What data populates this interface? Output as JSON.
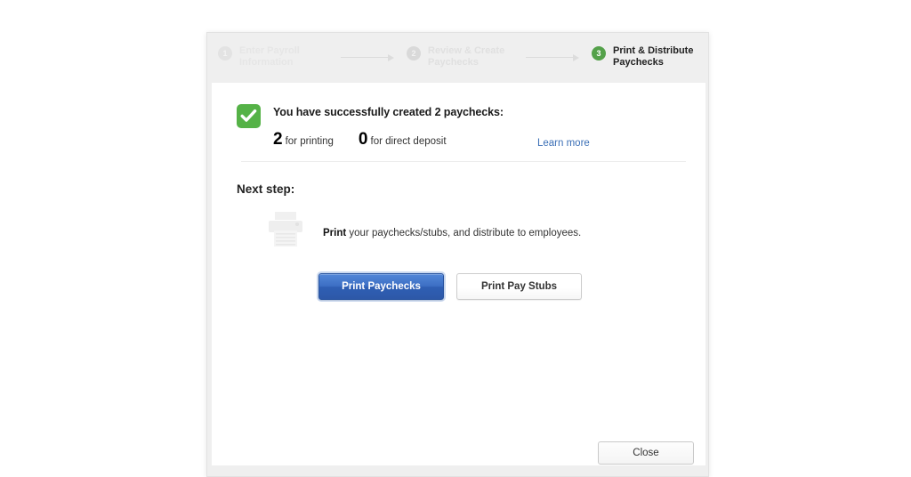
{
  "stepper": {
    "steps": [
      {
        "number": "1",
        "line1": "Enter Payroll",
        "line2": "Information",
        "state": "done-faint"
      },
      {
        "number": "2",
        "line1": "Review & Create",
        "line2": "Paychecks",
        "state": "done"
      },
      {
        "number": "3",
        "line1": "Print & Distribute",
        "line2": "Paychecks",
        "state": "active"
      }
    ]
  },
  "success": {
    "icon": "green-check-icon",
    "headline": "You have successfully created 2 paychecks:",
    "counts": [
      {
        "number": "2",
        "caption": "for printing"
      },
      {
        "number": "0",
        "caption": "for direct deposit"
      }
    ],
    "learn_more_label": "Learn more"
  },
  "next_step": {
    "title": "Next step:",
    "icon": "printer-icon",
    "description_bold": "Print",
    "description_rest": " your paychecks/stubs, and distribute to employees.",
    "primary_button": "Print Paychecks",
    "secondary_button": "Print Pay Stubs"
  },
  "footer": {
    "close_label": "Close"
  },
  "colors": {
    "active_step_green": "#54a14a",
    "check_green": "#55b247",
    "primary_blue": "#2f5fb4",
    "link_blue": "#3b6fb6",
    "dialog_bg": "#efefef",
    "content_bg": "#ffffff"
  }
}
